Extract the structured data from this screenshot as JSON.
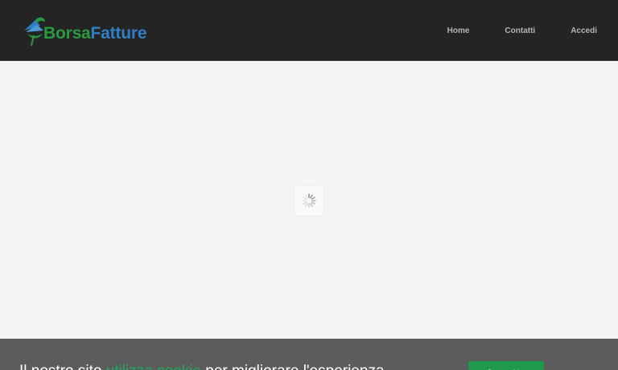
{
  "header": {
    "logo": {
      "text_part1": "Borsa",
      "text_part2": "Fatture",
      "mark_icon": "bird-leaf-logo-icon",
      "colors": {
        "green": "#2a9a3f",
        "blue": "#2f7fc4"
      }
    },
    "nav": [
      {
        "label": "Home"
      },
      {
        "label": "Contatti"
      },
      {
        "label": "Accedi"
      }
    ]
  },
  "main": {
    "loader_icon": "spinner-icon"
  },
  "cookie_bar": {
    "text_before": "Il nostro sito",
    "text_highlight": "utilizza cookie",
    "text_after": "per migliorare l'esperienza",
    "button_label": "Accetto",
    "colors": {
      "background": "#5c5c5c",
      "accent": "#1f9a4c"
    }
  }
}
